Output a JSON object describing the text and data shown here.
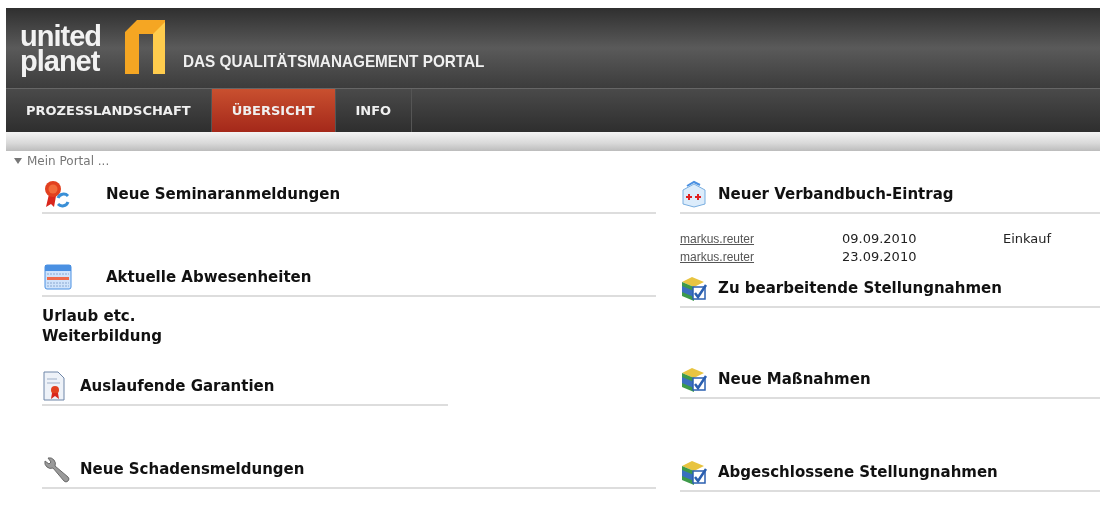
{
  "logo": {
    "line_1": "united",
    "line_2": "planet"
  },
  "header": {
    "title": "DAS QUALITÄTSMANAGEMENT PORTAL"
  },
  "tabs": [
    {
      "label": "PROZESSLANDSCHAFT",
      "selected": false
    },
    {
      "label": "ÜBERSICHT",
      "selected": true
    },
    {
      "label": "INFO",
      "selected": false
    }
  ],
  "section": {
    "label": "Mein Portal ...",
    "expanded": true
  },
  "left_column": [
    {
      "kind": "ribbon",
      "title": "Neue Seminaranmeldungen"
    },
    {
      "kind": "calendar",
      "title": "Aktuelle Abwesenheiten",
      "lines": [
        "Urlaub etc.",
        "Weiterbildung"
      ]
    },
    {
      "kind": "certificate",
      "title": "Auslaufende Garantien"
    },
    {
      "kind": "wrench",
      "title": "Neue Schadensmeldungen"
    }
  ],
  "right_column": [
    {
      "kind": "firstaid",
      "title": "Neuer Verbandbuch-Eintrag",
      "rows": [
        {
          "user": "markus.reuter",
          "date": "09.09.2010",
          "column_3": "Einkauf"
        },
        {
          "user": "markus.reuter",
          "date": "23.09.2010"
        }
      ]
    },
    {
      "kind": "books",
      "title": "Zu bearbeitende Stellungnahmen"
    },
    {
      "kind": "books",
      "title": "Neue Maßnahmen"
    },
    {
      "kind": "books",
      "title": "Abgeschlossene Stellungnahmen"
    }
  ]
}
